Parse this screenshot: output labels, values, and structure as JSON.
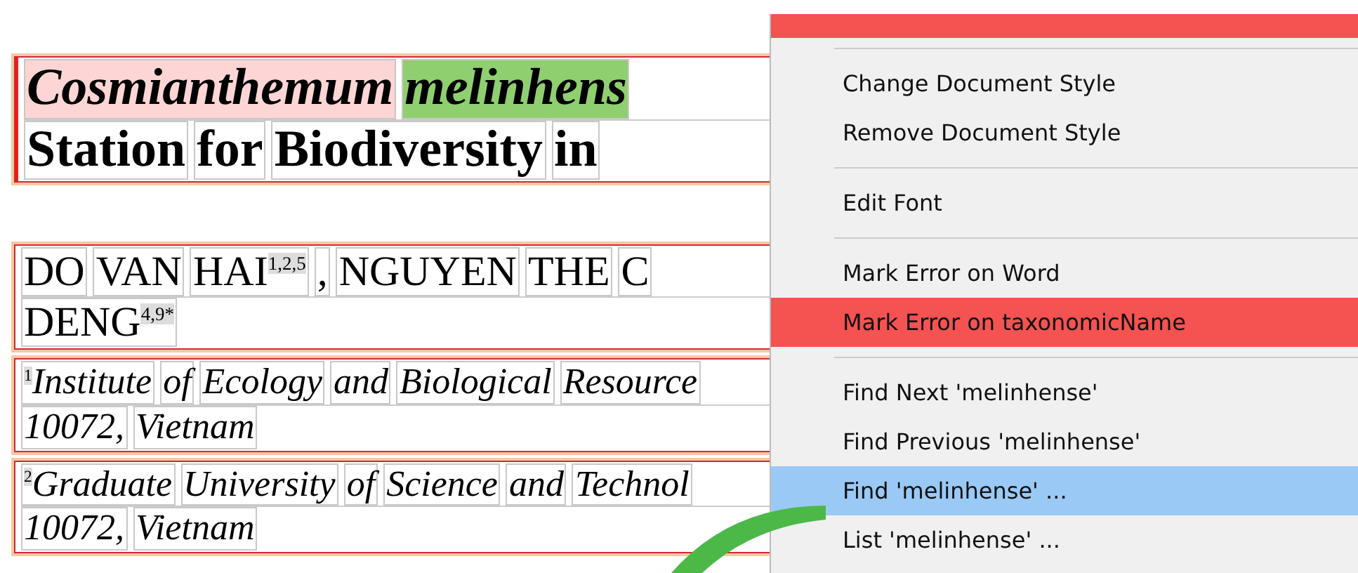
{
  "document": {
    "paragraphs": [
      {
        "kind": "title",
        "lines": [
          [
            {
              "text": "Cosmianthemum",
              "color": "#fdd5d5"
            },
            {
              "text": "melinhens",
              "color": "#8fcf70"
            }
          ],
          [
            {
              "text": "Station"
            },
            {
              "text": "for"
            },
            {
              "text": "Biodiversity"
            },
            {
              "text": "in"
            }
          ]
        ]
      },
      {
        "kind": "authors",
        "lines": [
          [
            {
              "text": "DO"
            },
            {
              "text": "VAN"
            },
            {
              "text": "HAI",
              "sup": "1,2,5"
            },
            {
              "text": ","
            },
            {
              "text": "NGUYEN"
            },
            {
              "text": "THE"
            },
            {
              "text": "C"
            }
          ],
          [
            {
              "text": "DENG",
              "sup": "4,9*"
            }
          ]
        ]
      },
      {
        "kind": "affiliation",
        "lines": [
          [
            {
              "text": "Institute",
              "pre": "1"
            },
            {
              "text": "of"
            },
            {
              "text": "Ecology"
            },
            {
              "text": "and"
            },
            {
              "text": "Biological"
            },
            {
              "text": "Resource"
            }
          ],
          [
            {
              "text": "10072,"
            },
            {
              "text": "Vietnam"
            }
          ]
        ]
      },
      {
        "kind": "affiliation",
        "lines": [
          [
            {
              "text": "Graduate",
              "pre": "2"
            },
            {
              "text": "University"
            },
            {
              "text": "of"
            },
            {
              "text": "Science"
            },
            {
              "text": "and"
            },
            {
              "text": "Technol"
            }
          ],
          [
            {
              "text": "10072,"
            },
            {
              "text": "Vietnam"
            }
          ]
        ]
      }
    ]
  },
  "context_menu": {
    "items": [
      {
        "kind": "item",
        "selected": false,
        "color": "#f55252"
      },
      {
        "kind": "separator"
      },
      {
        "kind": "item",
        "label": "Change Document Style",
        "selected": false
      },
      {
        "kind": "item",
        "label": "Remove Document Style",
        "selected": false
      },
      {
        "kind": "separator"
      },
      {
        "kind": "item",
        "label": "Edit Font",
        "selected": false
      },
      {
        "kind": "separator"
      },
      {
        "kind": "item",
        "label": "Mark Error on Word",
        "selected": false
      },
      {
        "kind": "item",
        "label": "Mark Error on taxonomicName",
        "selected": false,
        "color": "#f55252"
      },
      {
        "kind": "separator"
      },
      {
        "kind": "item",
        "label": "Find Next 'melinhense'",
        "selected": false
      },
      {
        "kind": "item",
        "label": "Find Previous 'melinhense'",
        "selected": false
      },
      {
        "kind": "item",
        "label": "Find 'melinhense' ...",
        "selected": true
      },
      {
        "kind": "item",
        "label": "List 'melinhense' ...",
        "selected": false
      }
    ]
  }
}
